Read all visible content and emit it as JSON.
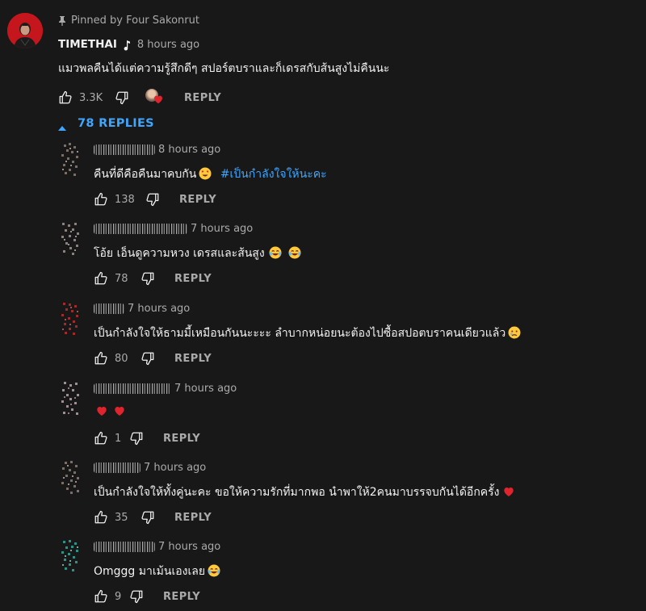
{
  "pinned_comment": {
    "pinned_by": "Pinned by Four Sakonrut",
    "author": "TIMETHAI",
    "timestamp": "8 hours ago",
    "text": "แมวพลคืนได้แต่ความรู้สึกดีๆ สปอร์ตบราและก็เดรสกับส้นสูงไม่คืนนะ",
    "likes": "3.3K",
    "reply_label": "REPLY",
    "replies_toggle": "78 REPLIES"
  },
  "colors": {
    "background": "#181818",
    "text_primary": "#f1f1f1",
    "text_secondary": "#aaaaaa",
    "link": "#3ea6ff",
    "heart": "#e0242e"
  },
  "replies": [
    {
      "timestamp": "8 hours ago",
      "text": "คืนที่ดีคือคืนมาคบกัน",
      "emoji": [
        "heart-eyes-emoji"
      ],
      "hashtag": "#เป็นกำลังใจให้นะคะ",
      "likes": "138",
      "reply_label": "REPLY"
    },
    {
      "timestamp": "7 hours ago",
      "text": "โอ้ย เอ็นดูความหวง เดรสและส้นสูง",
      "emoji": [
        "tears-of-joy-emoji",
        "tears-of-joy-emoji"
      ],
      "likes": "78",
      "reply_label": "REPLY"
    },
    {
      "timestamp": "7 hours ago",
      "text": "เป็นกำลังใจให้ธามมี้เหมือนกันนะะะะ ลำบากหน่อยนะต้องไปซื้อสปอตบราคนเดียวแล้ว",
      "emoji": [
        "crying-face-emoji"
      ],
      "likes": "80",
      "reply_label": "REPLY"
    },
    {
      "timestamp": "7 hours ago",
      "text": "",
      "emoji": [
        "red-heart-emoji",
        "red-heart-emoji"
      ],
      "likes": "1",
      "reply_label": "REPLY"
    },
    {
      "timestamp": "7 hours ago",
      "text": "เป็นกำลังใจให้ทั้งคู่นะคะ ขอให้ความรักที่มากพอ นำพาให้2คนมาบรรจบกันได้อีกครั้ง",
      "emoji": [
        "red-heart-emoji"
      ],
      "likes": "35",
      "reply_label": "REPLY"
    },
    {
      "timestamp": "7 hours ago",
      "text": "Omggg มาเม้นเองเลย",
      "emoji": [
        "tears-of-joy-emoji"
      ],
      "likes": "9",
      "reply_label": "REPLY"
    }
  ]
}
